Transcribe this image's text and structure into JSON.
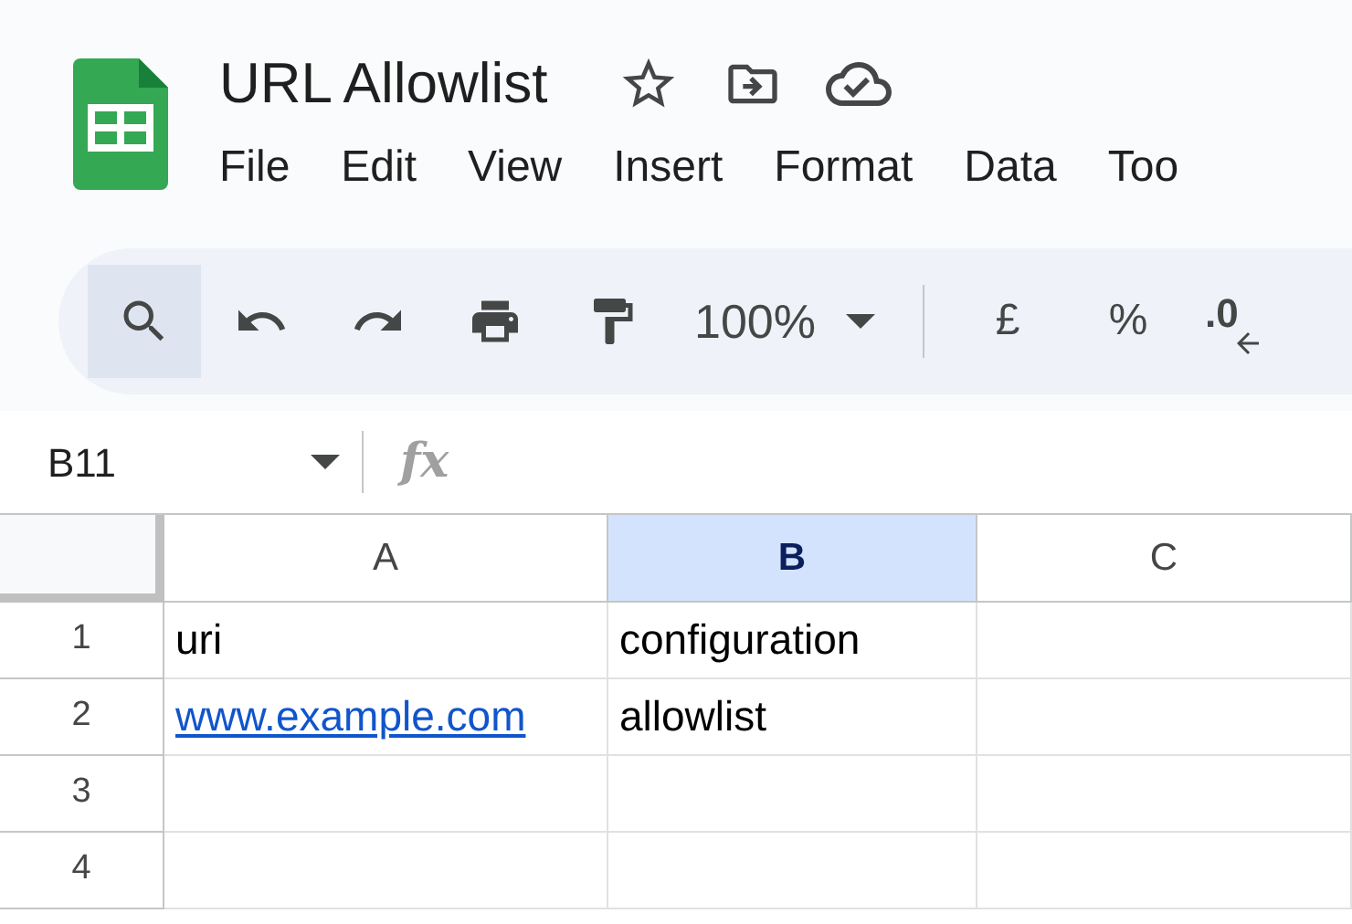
{
  "document": {
    "title": "URL Allowlist"
  },
  "menu": [
    "File",
    "Edit",
    "View",
    "Insert",
    "Format",
    "Data",
    "Too"
  ],
  "toolbar": [
    {
      "kind": "search",
      "active": true
    },
    {
      "kind": "undo",
      "active": false
    },
    {
      "kind": "redo",
      "active": false
    },
    {
      "kind": "print",
      "active": false
    },
    {
      "kind": "paint-format",
      "active": false
    },
    {
      "kind": "zoom",
      "label": "100%",
      "active": false
    },
    {
      "kind": "divider",
      "active": false
    },
    {
      "kind": "text",
      "label": "£",
      "active": false
    },
    {
      "kind": "text",
      "label": "%",
      "active": false
    },
    {
      "kind": "decimal",
      "label": ".0",
      "active": false
    }
  ],
  "formula_bar": {
    "name_box": "B11",
    "fx": "fx"
  },
  "sheet": {
    "columns": [
      {
        "label": "A",
        "selected": false
      },
      {
        "label": "B",
        "selected": true
      },
      {
        "label": "C",
        "selected": false
      }
    ],
    "rows": [
      {
        "number": "1",
        "cells": [
          {
            "text": "uri",
            "kind": "text"
          },
          {
            "text": "configuration",
            "kind": "text"
          }
        ]
      },
      {
        "number": "2",
        "cells": [
          {
            "text": "www.example.com",
            "kind": "link"
          },
          {
            "text": "allowlist",
            "kind": "text"
          }
        ]
      },
      {
        "number": "3",
        "cells": []
      },
      {
        "number": "4",
        "cells": []
      }
    ]
  }
}
